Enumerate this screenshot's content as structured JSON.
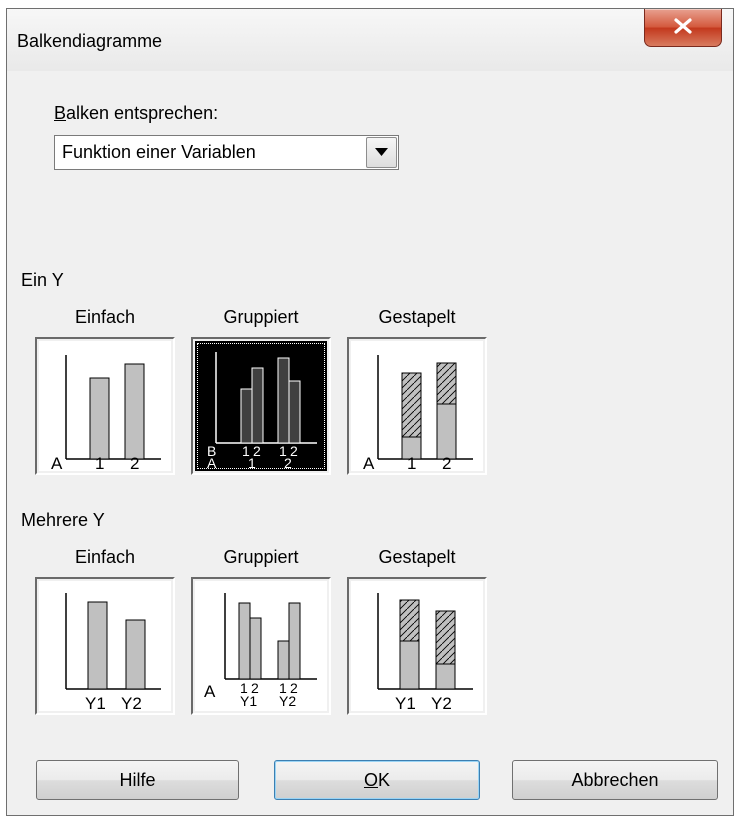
{
  "dialog": {
    "title": "Balkendiagramme",
    "close_glyph": "x"
  },
  "bars_represent": {
    "label_prefix": "B",
    "label_rest": "alken entsprechen:",
    "selected": "Funktion einer Variablen"
  },
  "one_y": {
    "heading": "Ein Y",
    "tiles": [
      {
        "caption": "Einfach",
        "axis_labels": [
          "A",
          "1",
          "2"
        ]
      },
      {
        "caption": "Gruppiert",
        "axis_labels": [
          "B",
          "1",
          "2",
          "1",
          "2",
          "A",
          "1",
          "2"
        ],
        "selected": true
      },
      {
        "caption": "Gestapelt",
        "axis_labels": [
          "A",
          "1",
          "2"
        ]
      }
    ]
  },
  "multi_y": {
    "heading": "Mehrere Y",
    "tiles": [
      {
        "caption": "Einfach",
        "axis_labels": [
          "Y1",
          "Y2"
        ]
      },
      {
        "caption": "Gruppiert",
        "axis_labels": [
          "A",
          "1",
          "2",
          "1",
          "2",
          "Y1",
          "Y2"
        ]
      },
      {
        "caption": "Gestapelt",
        "axis_labels": [
          "Y1",
          "Y2"
        ]
      }
    ]
  },
  "buttons": {
    "help": "Hilfe",
    "ok_prefix": "O",
    "ok_rest": "K",
    "cancel": "Abbrechen"
  },
  "colors": {
    "bar_fill": "#c0c0c0",
    "selected_tile": "#000000",
    "close_button": "#c84a31"
  }
}
